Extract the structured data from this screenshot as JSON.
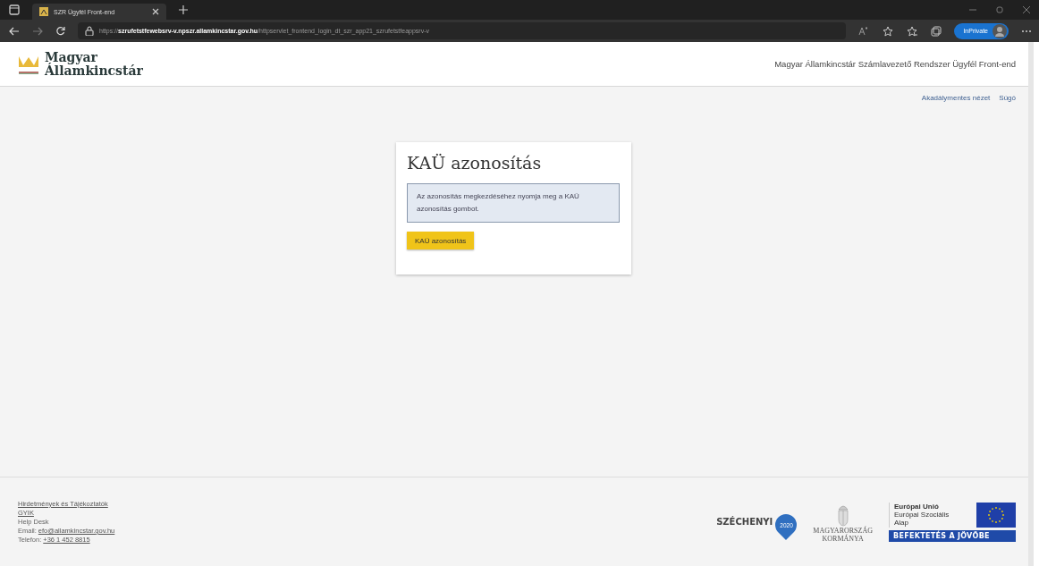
{
  "browser": {
    "tab_title": "SZR Ügyfél Front-end",
    "url_scheme": "https://",
    "url_host": "szrufetstfewebsrv-v.npszr.allamkincstar.gov.hu",
    "url_path": "/httpservlet_frontend_login_dt_szr_app21_szrufetstfeappsrv-v",
    "profile_label": "InPrivate"
  },
  "header": {
    "logo_lines": [
      "Magyar",
      "Államkincstár"
    ],
    "app_title": "Magyar Államkincstár Számlavezető Rendszer Ügyfél Front-end"
  },
  "top_links": [
    "Akadálymentes nézet",
    "Súgó"
  ],
  "card": {
    "title": "KAÜ azonosítás",
    "info": "Az azonosítás megkezdéséhez nyomja meg a KAÜ azonosítás gombot.",
    "button": "KAÜ azonosítás"
  },
  "footer": {
    "lines": [
      {
        "kind": "link",
        "text": "Hirdetmények és Tájékoztatók"
      },
      {
        "kind": "link",
        "text": "GYIK"
      },
      {
        "kind": "text",
        "text": "Help Desk"
      },
      {
        "kind": "labeled",
        "label": "Email:",
        "value": "efo@allamkincstar.gov.hu"
      },
      {
        "kind": "labeled",
        "label": "Telefon:",
        "value": "+36 1 452 8815"
      }
    ],
    "szechenyi": {
      "name": "SZÉCHENYI",
      "year": "2020"
    },
    "government": [
      "MAGYARORSZÁG",
      "KORMÁNYA"
    ],
    "eu": {
      "title": "Európai Unió",
      "fund": "Európai Szociális Alap",
      "slogan": "BEFEKTETÉS A JÖVŐBE"
    }
  }
}
